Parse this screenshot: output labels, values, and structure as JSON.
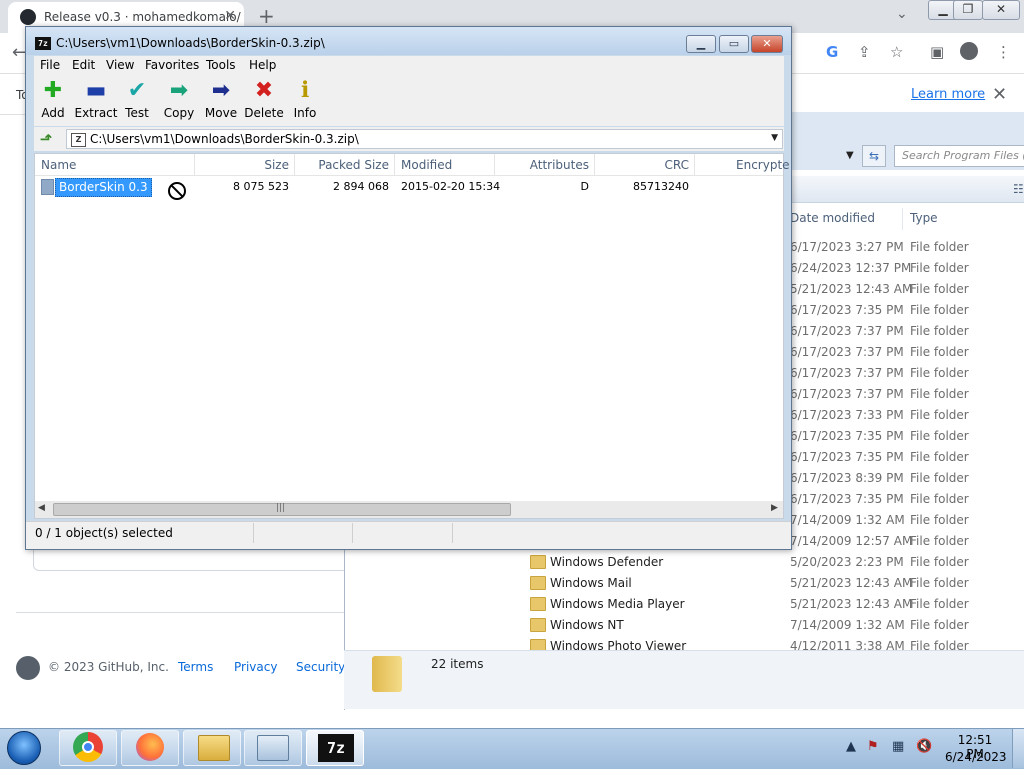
{
  "chrome": {
    "tab_title": "Release v0.3 · mohamedkomalo/",
    "infobar_text": "To",
    "learn_more": "Learn more"
  },
  "github": {
    "copyright": "© 2023 GitHub, Inc.",
    "links": [
      "Terms",
      "Privacy",
      "Security"
    ]
  },
  "explorer": {
    "search_placeholder": "Search Program Files (x",
    "columns": {
      "date": "Date modified",
      "type": "Type"
    },
    "rows": [
      {
        "name": "",
        "date": "6/17/2023 3:27 PM",
        "type": "File folder"
      },
      {
        "name": "",
        "date": "6/24/2023 12:37 PM",
        "type": "File folder"
      },
      {
        "name": "",
        "date": "5/21/2023 12:43 AM",
        "type": "File folder"
      },
      {
        "name": "",
        "date": "6/17/2023 7:35 PM",
        "type": "File folder"
      },
      {
        "name": "",
        "date": "6/17/2023 7:37 PM",
        "type": "File folder"
      },
      {
        "name": "",
        "date": "6/17/2023 7:37 PM",
        "type": "File folder"
      },
      {
        "name": "",
        "date": "6/17/2023 7:37 PM",
        "type": "File folder"
      },
      {
        "name": "",
        "date": "6/17/2023 7:37 PM",
        "type": "File folder"
      },
      {
        "name": "",
        "date": "6/17/2023 7:33 PM",
        "type": "File folder"
      },
      {
        "name": "",
        "date": "6/17/2023 7:35 PM",
        "type": "File folder"
      },
      {
        "name": "",
        "date": "6/17/2023 7:35 PM",
        "type": "File folder"
      },
      {
        "name": "",
        "date": "6/17/2023 8:39 PM",
        "type": "File folder"
      },
      {
        "name": "",
        "date": "6/17/2023 7:35 PM",
        "type": "File folder"
      },
      {
        "name": "",
        "date": "7/14/2009 1:32 AM",
        "type": "File folder"
      },
      {
        "name": "",
        "date": "7/14/2009 12:57 AM",
        "type": "File folder"
      },
      {
        "name": "Windows Defender",
        "date": "5/20/2023 2:23 PM",
        "type": "File folder"
      },
      {
        "name": "Windows Mail",
        "date": "5/21/2023 12:43 AM",
        "type": "File folder"
      },
      {
        "name": "Windows Media Player",
        "date": "5/21/2023 12:43 AM",
        "type": "File folder"
      },
      {
        "name": "Windows NT",
        "date": "7/14/2009 1:32 AM",
        "type": "File folder"
      },
      {
        "name": "Windows Photo Viewer",
        "date": "4/12/2011 3:38 AM",
        "type": "File folder"
      }
    ],
    "items_count": "22 items"
  },
  "sevenzip": {
    "title": "C:\\Users\\vm1\\Downloads\\BorderSkin-0.3.zip\\",
    "title_icon": "7z",
    "menu": [
      "File",
      "Edit",
      "View",
      "Favorites",
      "Tools",
      "Help"
    ],
    "toolbar": [
      {
        "label": "Add",
        "icon": "plus-icon",
        "glyph": "✚",
        "color": "#22aa22"
      },
      {
        "label": "Extract",
        "icon": "minus-icon",
        "glyph": "▬",
        "color": "#1e3fa8"
      },
      {
        "label": "Test",
        "icon": "check-icon",
        "glyph": "✔",
        "color": "#1aa6a6"
      },
      {
        "label": "Copy",
        "icon": "right-arrow-icon",
        "glyph": "➡",
        "color": "#1aa37a"
      },
      {
        "label": "Move",
        "icon": "right-arrow-icon",
        "glyph": "➡",
        "color": "#1e2f8f"
      },
      {
        "label": "Delete",
        "icon": "x-icon",
        "glyph": "✖",
        "color": "#d41f1f"
      },
      {
        "label": "Info",
        "icon": "info-icon",
        "glyph": "ℹ",
        "color": "#b89a00"
      }
    ],
    "path": "C:\\Users\\vm1\\Downloads\\BorderSkin-0.3.zip\\",
    "columns": [
      "Name",
      "Size",
      "Packed Size",
      "Modified",
      "Attributes",
      "CRC",
      "Encrypte"
    ],
    "file": {
      "name": "BorderSkin 0.3",
      "size": "8 075 523",
      "packed": "2 894 068",
      "modified": "2015-02-20 15:34",
      "attributes": "D",
      "crc": "85713240"
    },
    "status": "0 / 1 object(s) selected"
  },
  "taskbar": {
    "seven_zip_label": "7z",
    "time": "12:51 PM",
    "date": "6/24/2023"
  }
}
